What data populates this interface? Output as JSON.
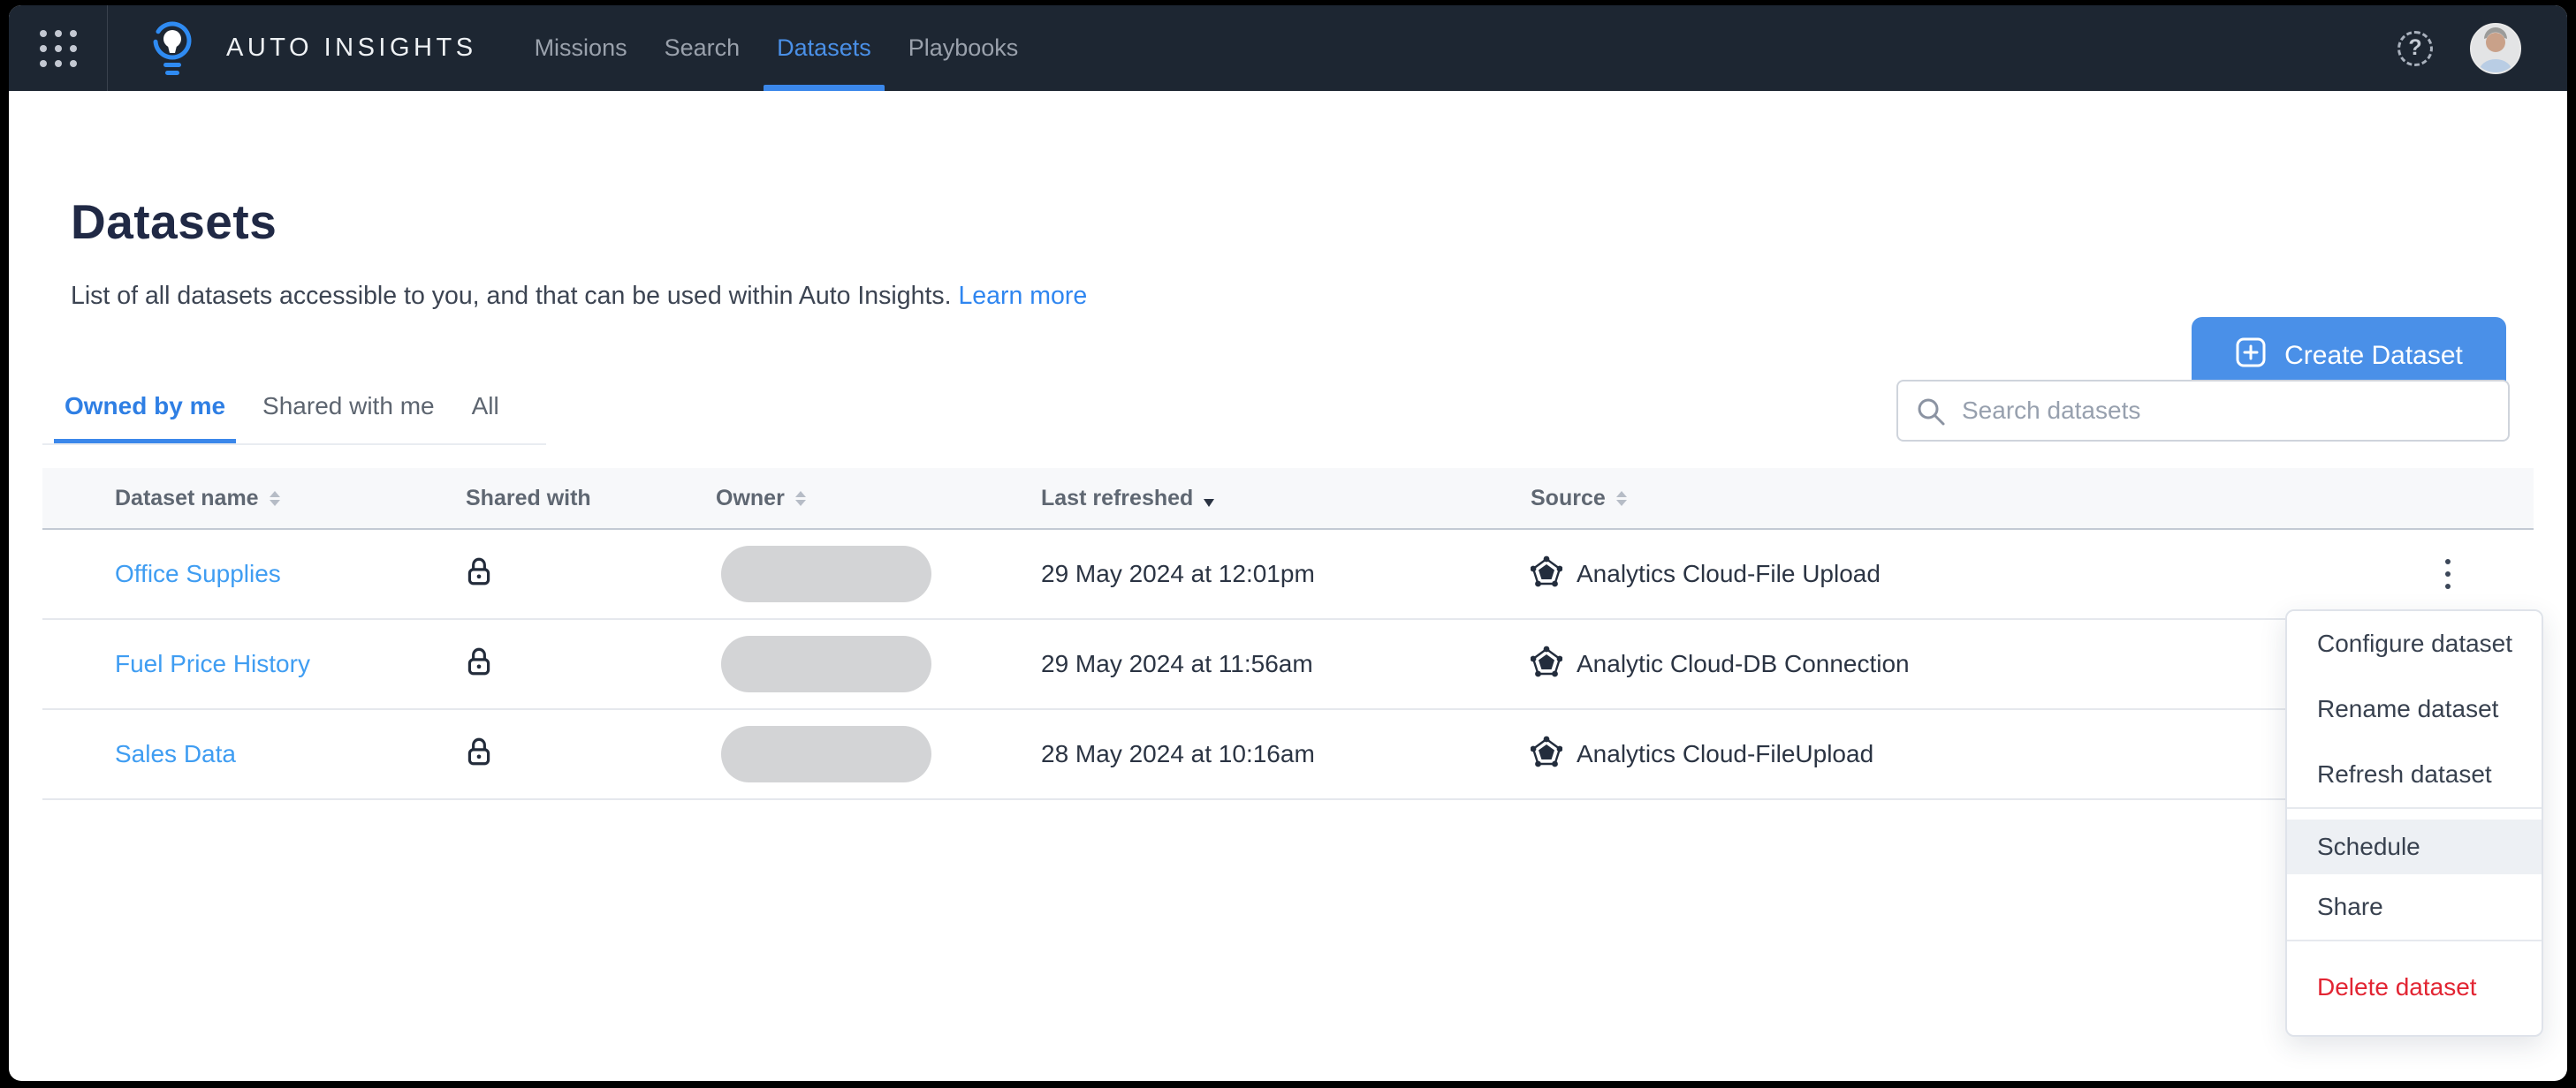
{
  "nav": {
    "brand": "AUTO INSIGHTS",
    "items": [
      {
        "label": "Missions",
        "active": false
      },
      {
        "label": "Search",
        "active": false
      },
      {
        "label": "Datasets",
        "active": true
      },
      {
        "label": "Playbooks",
        "active": false
      }
    ],
    "help_glyph": "?"
  },
  "page": {
    "title": "Datasets",
    "subtitle": "List of all datasets accessible to you, and that can be used within Auto Insights.",
    "learn_more_label": "Learn more",
    "create_dataset_label": "Create Dataset"
  },
  "tabs": [
    {
      "label": "Owned by me",
      "active": true
    },
    {
      "label": "Shared with me",
      "active": false
    },
    {
      "label": "All",
      "active": false
    }
  ],
  "search": {
    "placeholder": "Search datasets"
  },
  "table": {
    "columns": [
      {
        "label": "Dataset name",
        "sort": "both"
      },
      {
        "label": "Shared with",
        "sort": "none"
      },
      {
        "label": "Owner",
        "sort": "both"
      },
      {
        "label": "Last refreshed",
        "sort": "desc"
      },
      {
        "label": "Source",
        "sort": "both"
      }
    ],
    "rows": [
      {
        "name": "Office Supplies",
        "shared_with_icon": "lock-icon",
        "owner_redacted": true,
        "last_refreshed": "29 May 2024 at 12:01pm",
        "source": "Analytics Cloud-File Upload"
      },
      {
        "name": "Fuel Price History",
        "shared_with_icon": "lock-icon",
        "owner_redacted": true,
        "last_refreshed": "29 May 2024 at 11:56am",
        "source": "Analytic Cloud-DB Connection"
      },
      {
        "name": "Sales Data",
        "shared_with_icon": "lock-icon",
        "owner_redacted": true,
        "last_refreshed": "28 May 2024 at 10:16am",
        "source": "Analytics Cloud-FileUpload"
      }
    ]
  },
  "context_menu": {
    "items": [
      {
        "label": "Configure dataset"
      },
      {
        "label": "Rename dataset"
      },
      {
        "label": "Refresh dataset"
      },
      {
        "label": "Schedule",
        "highlighted": true
      },
      {
        "label": "Share"
      },
      {
        "label": "Delete dataset",
        "danger": true
      }
    ]
  },
  "colors": {
    "nav_bg": "#1d2632",
    "accent_blue": "#4a90e8",
    "link_blue": "#3f9df2",
    "danger_red": "#e22533",
    "owner_redacted_pill": "#d3d4d6",
    "schedule_highlight": "#edf0f4"
  }
}
